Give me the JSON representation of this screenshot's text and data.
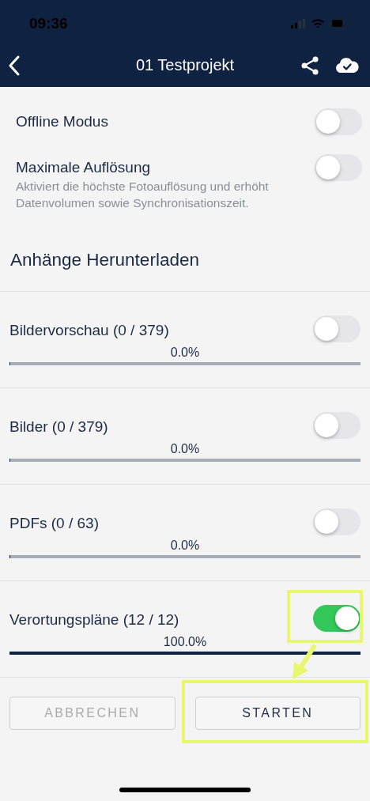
{
  "status_bar": {
    "time": "09:36"
  },
  "header": {
    "title": "01 Testprojekt"
  },
  "settings": [
    {
      "label": "Offline Modus",
      "on": false
    },
    {
      "label": "Maximale Auflösung",
      "description": "Aktiviert die höchste Fotoauflösung und erhöht Datenvolumen sowie Synchronisationszeit.",
      "on": false
    }
  ],
  "section_title": "Anhänge Herunterladen",
  "downloads": [
    {
      "label": "Bildervorschau (0 / 379)",
      "on": false,
      "level": 0,
      "percent": "0.0%",
      "highlighted": false
    },
    {
      "label": "Bilder (0 / 379)",
      "on": false,
      "level": 0,
      "percent": "0.0%",
      "highlighted": false
    },
    {
      "label": "PDFs (0 / 63)",
      "on": false,
      "level": 0,
      "percent": "0.0%",
      "highlighted": false
    },
    {
      "label": "Verortungspläne (12 / 12)",
      "on": true,
      "level": 1,
      "percent": "100.0%",
      "highlighted": true
    }
  ],
  "buttons": [
    {
      "label": "ABBRECHEN",
      "disabled": true,
      "highlighted": false
    },
    {
      "label": "STARTEN",
      "disabled": false,
      "highlighted": true
    }
  ]
}
